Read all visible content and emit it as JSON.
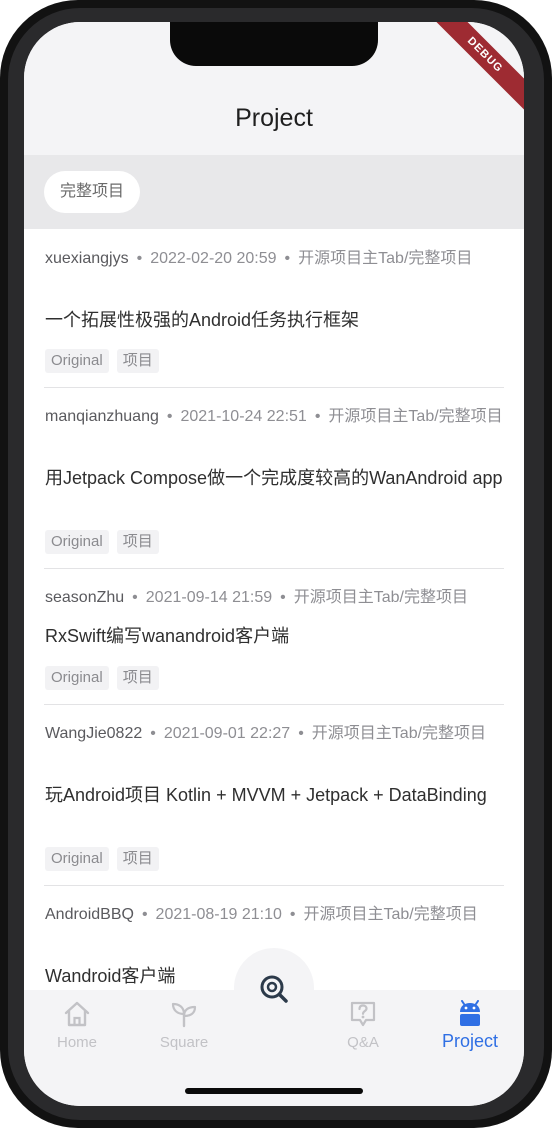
{
  "debug_banner": "DEBUG",
  "header": {
    "title": "Project"
  },
  "category_tabs": [
    {
      "label": "完整项目",
      "selected": true
    }
  ],
  "articles": [
    {
      "author": "xuexiangjys",
      "date": "2022-02-20 20:59",
      "category": "开源项目主Tab/完整项目",
      "title": "一个拓展性极强的Android任务执行框架",
      "tags": [
        "Original",
        "项目"
      ]
    },
    {
      "author": "manqianzhuang",
      "date": "2021-10-24 22:51",
      "category": "开源项目主Tab/完整项目",
      "title": "用Jetpack Compose做一个完成度较高的WanAndroid app",
      "tags": [
        "Original",
        "项目"
      ]
    },
    {
      "author": "seasonZhu",
      "date": "2021-09-14 21:59",
      "category": "开源项目主Tab/完整项目",
      "title": "RxSwift编写wanandroid客户端",
      "tags": [
        "Original",
        "项目"
      ]
    },
    {
      "author": "WangJie0822",
      "date": "2021-09-01 22:27",
      "category": "开源项目主Tab/完整项目",
      "title": "玩Android项目 Kotlin + MVVM + Jetpack + DataBinding",
      "tags": [
        "Original",
        "项目"
      ]
    },
    {
      "author": "AndroidBBQ",
      "date": "2021-08-19 21:10",
      "category": "开源项目主Tab/完整项目",
      "title": "Wandroid客户端",
      "tags": []
    }
  ],
  "meta_separator": "•",
  "bottom_nav": {
    "items": [
      {
        "label": "Home",
        "icon": "home-icon",
        "active": false
      },
      {
        "label": "Square",
        "icon": "sprout-icon",
        "active": false
      },
      {
        "label": "Q&A",
        "icon": "question-icon",
        "active": false
      },
      {
        "label": "Project",
        "icon": "android-icon",
        "active": true
      }
    ],
    "center_button_icon": "search-icon"
  },
  "colors": {
    "accent": "#2f6fe4",
    "inactive": "#c2c2c6",
    "debug": "#9e2b32"
  }
}
